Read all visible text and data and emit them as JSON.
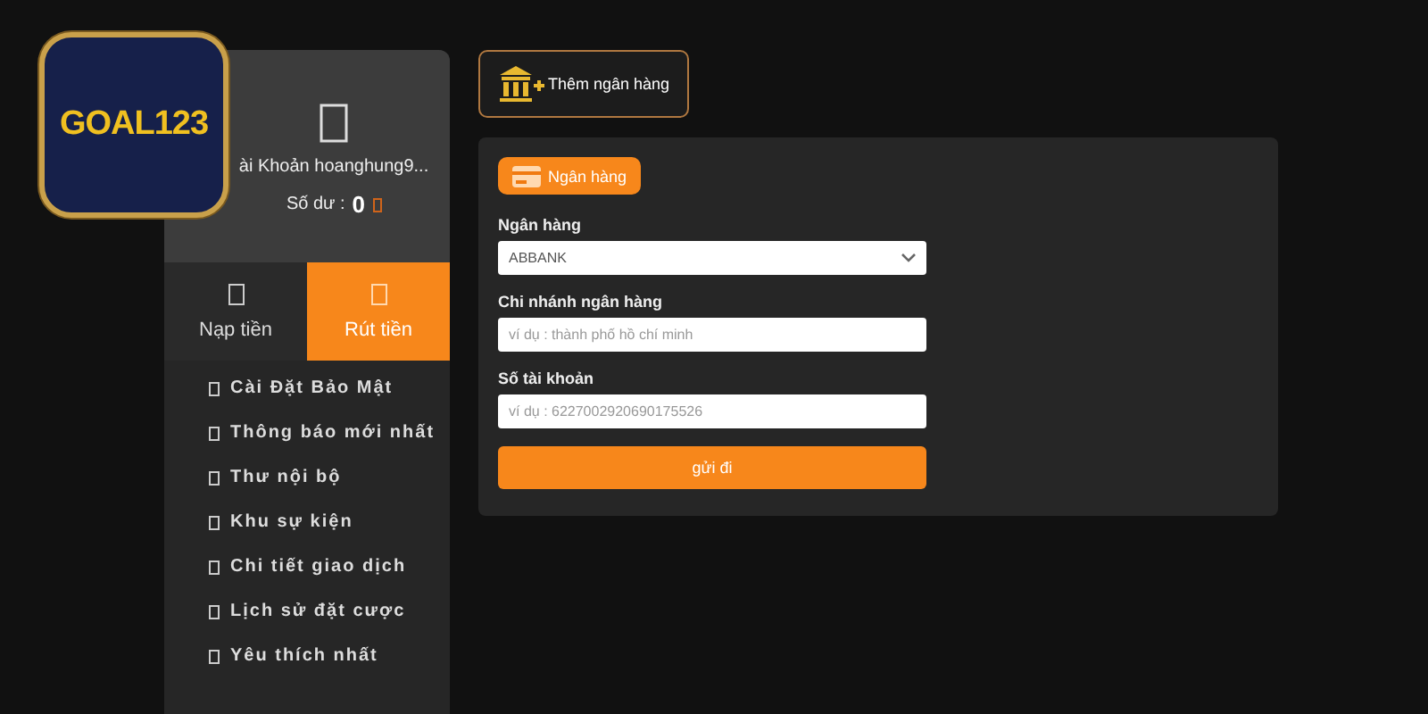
{
  "logo": {
    "text": "GOAL123"
  },
  "account": {
    "name": "ài Khoản hoanghung9...",
    "balance_label": "Số dư :",
    "balance": "0"
  },
  "tabs": [
    {
      "label": "Nạp tiền",
      "selected": false
    },
    {
      "label": "Rút tiền",
      "selected": true
    }
  ],
  "menu": [
    "Cài Đặt Bảo Mật",
    "Thông báo mới nhất",
    "Thư nội bộ",
    "Khu sự kiện",
    "Chi tiết giao dịch",
    "Lịch sử đặt cược",
    "Yêu thích nhất"
  ],
  "add_bank_button": "Thêm ngân hàng",
  "form": {
    "badge": "Ngân hàng",
    "fields": [
      {
        "kind": "select",
        "label": "Ngân hàng",
        "value": "ABBANK"
      },
      {
        "kind": "input",
        "label": "Chi nhánh ngân hàng",
        "placeholder": "ví dụ : thành phố hồ chí minh"
      },
      {
        "kind": "input",
        "label": "Số tài khoản",
        "placeholder": "ví dụ : 6227002920690175526"
      }
    ],
    "submit": "gửi đi"
  }
}
